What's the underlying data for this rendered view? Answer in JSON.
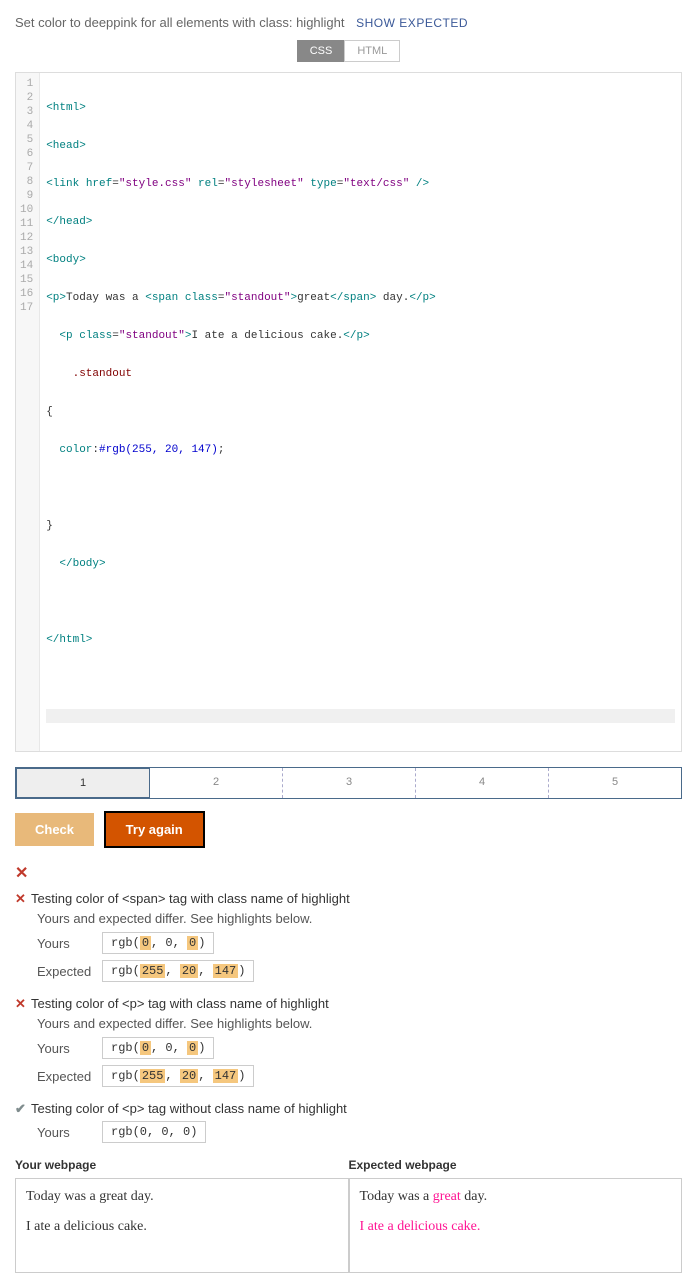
{
  "instruction": "Set color to deeppink for all elements with class: highlight",
  "show_expected": "SHOW EXPECTED",
  "lang_tabs": {
    "css": "CSS",
    "html": "HTML"
  },
  "code": {
    "l1": "<html>",
    "l2": "<head>",
    "l3a": "<link ",
    "l3b": "href",
    "l3c": "=",
    "l3d": "\"style.css\"",
    "l3e": " rel",
    "l3f": "=",
    "l3g": "\"stylesheet\"",
    "l3h": " type",
    "l3i": "=",
    "l3j": "\"text/css\"",
    "l3k": " />",
    "l4": "</head>",
    "l5": "<body>",
    "l6a": "<p>",
    "l6b": "Today was a ",
    "l6c": "<span ",
    "l6d": "class",
    "l6e": "=",
    "l6f": "\"standout\"",
    "l6g": ">",
    "l6h": "great",
    "l6i": "</span>",
    "l6j": " day.",
    "l6k": "</p>",
    "l7a": "  <p ",
    "l7b": "class",
    "l7c": "=",
    "l7d": "\"standout\"",
    "l7e": ">",
    "l7f": "I ate a delicious cake.",
    "l7g": "</p>",
    "l8": "    .standout",
    "l9": "{",
    "l10a": "  color",
    "l10b": ":",
    "l10c": "#rgb(255, 20, 147)",
    "l10d": ";",
    "l12": "}",
    "l13": "  </body>",
    "l15": "</html>"
  },
  "num_tabs": [
    "1",
    "2",
    "3",
    "4",
    "5"
  ],
  "buttons": {
    "check": "Check",
    "try": "Try again"
  },
  "overall_x": "✕",
  "tests": {
    "t1": {
      "icon": "✕",
      "head": "Testing color of <span> tag with class name of highlight",
      "diff": "Yours and expected differ. See highlights below.",
      "yours_label": "Yours",
      "yours_pre": "rgb(",
      "yours_a": "0",
      "yours_m1": ", 0, ",
      "yours_b": "0",
      "yours_post": ")",
      "exp_label": "Expected",
      "exp_pre": "rgb(",
      "exp_a": "255",
      "exp_m1": ", ",
      "exp_b": "20",
      "exp_m2": ", ",
      "exp_c": "147",
      "exp_post": ")"
    },
    "t2": {
      "icon": "✕",
      "head": "Testing color of <p> tag with class name of highlight",
      "diff": "Yours and expected differ. See highlights below.",
      "yours_label": "Yours",
      "yours_pre": "rgb(",
      "yours_a": "0",
      "yours_m1": ", 0, ",
      "yours_b": "0",
      "yours_post": ")",
      "exp_label": "Expected",
      "exp_pre": "rgb(",
      "exp_a": "255",
      "exp_m1": ", ",
      "exp_b": "20",
      "exp_m2": ", ",
      "exp_c": "147",
      "exp_post": ")"
    },
    "t3": {
      "icon": "✔",
      "head": "Testing color of <p> tag without class name of highlight",
      "yours_label": "Yours",
      "yours_val": "rgb(0, 0, 0)"
    }
  },
  "webpages": {
    "your_title": "Your webpage",
    "expected_title": "Expected webpage",
    "p1a": "Today was a ",
    "p1b": "great",
    "p1c": " day.",
    "p2": "I ate a delicious cake."
  }
}
